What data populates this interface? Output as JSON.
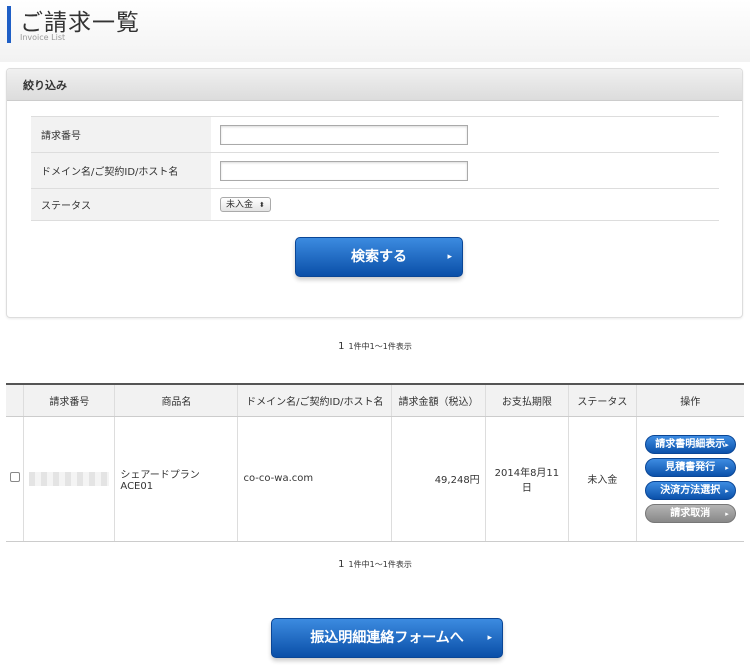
{
  "header": {
    "title": "ご請求一覧",
    "subtitle": "Invoice List"
  },
  "filter": {
    "heading": "絞り込み",
    "fields": [
      {
        "label": "請求番号",
        "value": ""
      },
      {
        "label": "ドメイン名/ご契約ID/ホスト名",
        "value": ""
      },
      {
        "label": "ステータス",
        "selected": "未入金"
      }
    ],
    "search_label": "検索する"
  },
  "pager": {
    "current": "1",
    "summary": "1件中1～1件表示"
  },
  "table": {
    "headers": [
      "",
      "請求番号",
      "商品名",
      "ドメイン名/ご契約ID/ホスト名",
      "請求金額（税込）",
      "お支払期限",
      "ステータス",
      "操作"
    ],
    "rows": [
      {
        "product": "シェアードプラン ACE01",
        "domain": "co-co-wa.com",
        "amount": "49,248円",
        "due": "2014年8月11日",
        "status": "未入金",
        "actions": [
          "請求書明細表示",
          "見積書発行",
          "決済方法選択",
          "請求取消"
        ]
      }
    ]
  },
  "footer": {
    "transfer_label": "振込明細連絡フォームへ"
  },
  "icons": {
    "chevron": "chevron-right-icon",
    "select_arrow": "select-arrow-icon"
  },
  "colors": {
    "accent": "#1f5fc6",
    "button_blue": "#0a4fa8",
    "button_gray": "#888888"
  }
}
